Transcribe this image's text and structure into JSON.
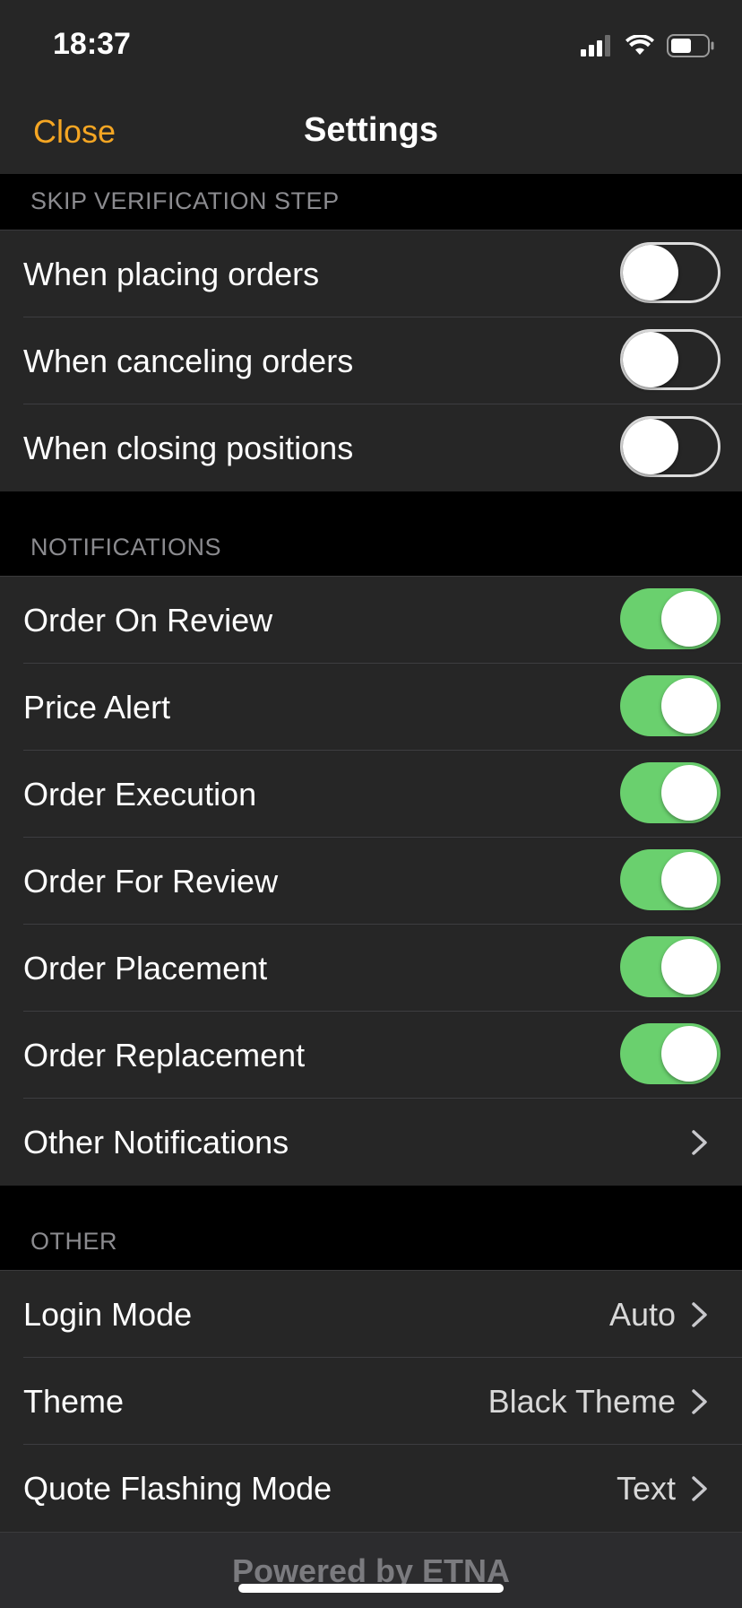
{
  "status": {
    "time": "18:37"
  },
  "nav": {
    "close_label": "Close",
    "title": "Settings"
  },
  "sections": {
    "skip": {
      "header": "SKIP VERIFICATION STEP",
      "items": [
        {
          "label": "When placing orders",
          "on": false
        },
        {
          "label": "When canceling orders",
          "on": false
        },
        {
          "label": "When closing positions",
          "on": false
        }
      ]
    },
    "notifications": {
      "header": "NOTIFICATIONS",
      "items": [
        {
          "label": "Order On Review",
          "on": true
        },
        {
          "label": "Price Alert",
          "on": true
        },
        {
          "label": "Order Execution",
          "on": true
        },
        {
          "label": "Order For Review",
          "on": true
        },
        {
          "label": "Order Placement",
          "on": true
        },
        {
          "label": "Order Replacement",
          "on": true
        }
      ],
      "other_label": "Other Notifications"
    },
    "other": {
      "header": "OTHER",
      "items": [
        {
          "label": "Login Mode",
          "value": "Auto"
        },
        {
          "label": "Theme",
          "value": "Black Theme"
        },
        {
          "label": "Quote Flashing Mode",
          "value": "Text"
        }
      ]
    }
  },
  "footer": {
    "text": "Powered by ETNA"
  },
  "colors": {
    "accent": "#f5a623",
    "toggle_on": "#6ad06e",
    "background": "#000000",
    "cell": "#262626"
  },
  "icons": [
    "signal-icon",
    "wifi-icon",
    "battery-icon",
    "chevron-right-icon"
  ]
}
